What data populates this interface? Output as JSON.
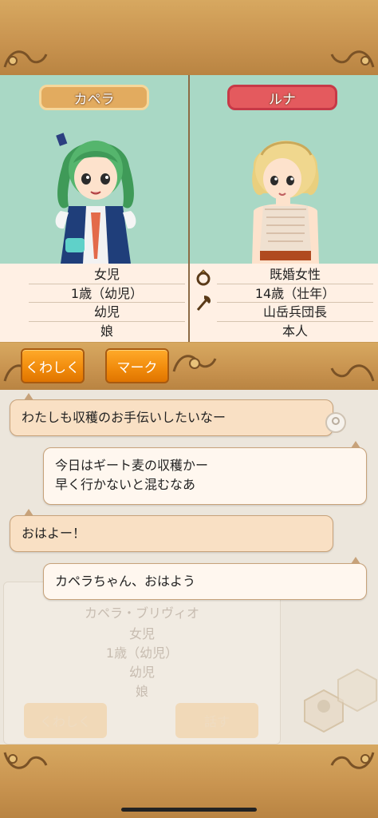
{
  "characters": {
    "left": {
      "name": "カペラ",
      "stats": [
        "女児",
        "1歳（幼児）",
        "幼児",
        "娘"
      ]
    },
    "right": {
      "name": "ルナ",
      "stats": [
        "既婚女性",
        "14歳（壮年）",
        "山岳兵団長",
        "本人"
      ]
    }
  },
  "actions": {
    "detail_label": "くわしく",
    "mark_label": "マーク"
  },
  "chat": [
    {
      "speaker": "left",
      "text": "わたしも収穫のお手伝いしたいなー"
    },
    {
      "speaker": "right",
      "text": "今日はギート麦の収穫かー\n早く行かないと混むなあ"
    },
    {
      "speaker": "left",
      "text": "おはよー！"
    },
    {
      "speaker": "right",
      "text": "カペラちゃん、おはよう"
    }
  ],
  "background_panel": {
    "name": "カペラ・ブリヴィオ",
    "lines": [
      "女児",
      "1歳（幼児）",
      "幼児",
      "娘"
    ],
    "detail_label": "くわしく",
    "talk_label": "話す"
  },
  "colors": {
    "wood": "#c99450",
    "portrait_bg": "#a9d8c5",
    "name_left": "#e2ab5f",
    "name_right": "#e45a5e",
    "button": "#f08a0b",
    "bubble": "#f9e0c4"
  },
  "icons": {
    "ring": "ring-icon",
    "axe": "axe-icon"
  }
}
